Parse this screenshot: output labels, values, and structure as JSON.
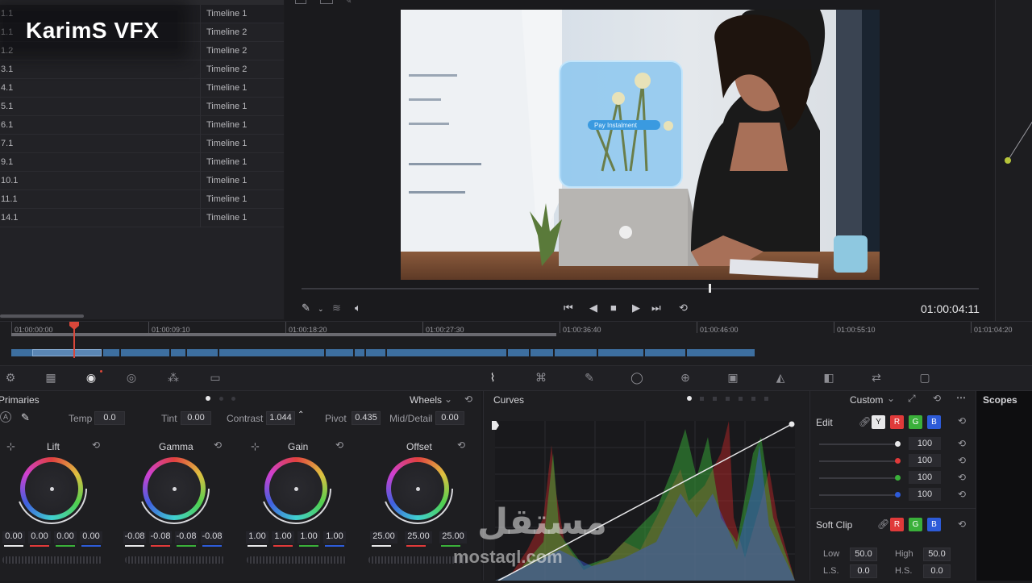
{
  "brand": {
    "text": "KarimS VFX"
  },
  "timelines": {
    "rows": [
      {
        "id": "1.1",
        "name": "Timeline 1"
      },
      {
        "id": "1.1",
        "name": "Timeline 2"
      },
      {
        "id": "1.2",
        "name": "Timeline 2"
      },
      {
        "id": "3.1",
        "name": "Timeline 2"
      },
      {
        "id": "4.1",
        "name": "Timeline 1"
      },
      {
        "id": "5.1",
        "name": "Timeline 1"
      },
      {
        "id": "6.1",
        "name": "Timeline 1"
      },
      {
        "id": "7.1",
        "name": "Timeline 1"
      },
      {
        "id": "9.1",
        "name": "Timeline 1"
      },
      {
        "id": "10.1",
        "name": "Timeline 1"
      },
      {
        "id": "11.1",
        "name": "Timeline 1"
      },
      {
        "id": "14.1",
        "name": "Timeline 1"
      }
    ]
  },
  "viewer": {
    "timecode": "01:00:04:11",
    "overlay_label": "Pay Instalment"
  },
  "ruler": {
    "ticks": [
      "01:00:00:00",
      "01:00:09:10",
      "01:00:18:20",
      "01:00:27:30",
      "01:00:36:40",
      "01:00:46:00",
      "01:00:55:10",
      "01:01:04:20"
    ]
  },
  "primaries": {
    "title": "Primaries",
    "mode": "Wheels",
    "temp_label": "Temp",
    "temp": "0.0",
    "tint_label": "Tint",
    "tint": "0.00",
    "contrast_label": "Contrast",
    "contrast": "1.044",
    "pivot_label": "Pivot",
    "pivot": "0.435",
    "middetail_label": "Mid/Detail",
    "middetail": "0.00",
    "wheels": [
      {
        "name": "Lift",
        "values": [
          "0.00",
          "0.00",
          "0.00",
          "0.00"
        ]
      },
      {
        "name": "Gamma",
        "values": [
          "-0.08",
          "-0.08",
          "-0.08",
          "-0.08"
        ]
      },
      {
        "name": "Gain",
        "values": [
          "1.00",
          "1.00",
          "1.00",
          "1.00"
        ]
      },
      {
        "name": "Offset",
        "values": [
          "25.00",
          "25.00",
          "25.00"
        ]
      }
    ]
  },
  "curves": {
    "title": "Curves",
    "mode": "Custom"
  },
  "edit": {
    "label": "Edit",
    "channels": [
      "Y",
      "R",
      "G",
      "B"
    ],
    "values": [
      "100",
      "100",
      "100",
      "100"
    ],
    "softclip_label": "Soft Clip",
    "low_label": "Low",
    "low": "50.0",
    "high_label": "High",
    "high": "50.0",
    "ls_label": "L.S.",
    "ls": "0.0",
    "hs_label": "H.S.",
    "hs": "0.0"
  },
  "scopes": {
    "title": "Scopes"
  },
  "watermark": {
    "arabic": "مستقل",
    "latin": "mostaql.com"
  },
  "colors": {
    "accent_blue": "#3d6fa0",
    "playhead_red": "#d9473a",
    "red": "#e03a3a",
    "green": "#3ab03a",
    "blue": "#2d5bd8"
  }
}
